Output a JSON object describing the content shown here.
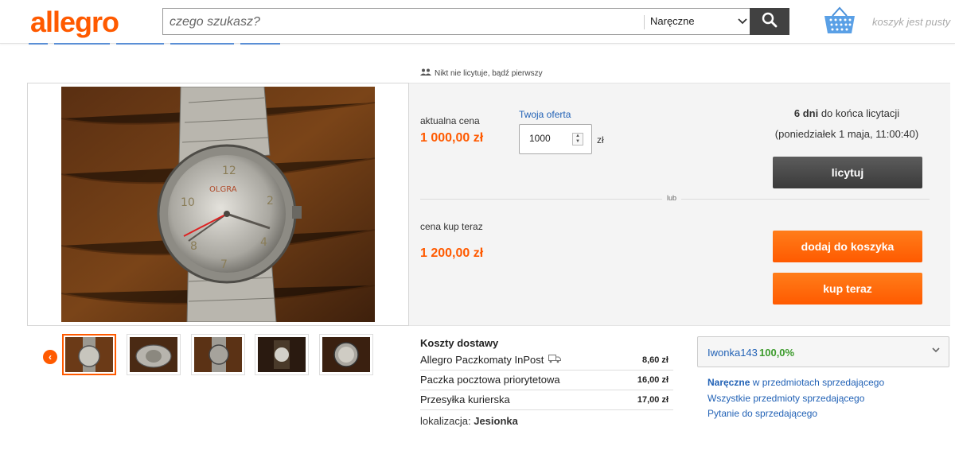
{
  "header": {
    "logo": "allegro",
    "search_placeholder": "czego szukasz?",
    "category": "Naręczne",
    "cart_text": "koszyk jest pusty"
  },
  "bid": {
    "note": "Nikt nie licytuje, bądź pierwszy",
    "current_price_label": "aktualna cena",
    "current_price": "1 000,00 zł",
    "offer_label": "Twoja oferta",
    "offer_value": "1000",
    "currency": "zł",
    "days_bold": "6 dni",
    "days_rest": " do końca licytacji",
    "end_date": "(poniedziałek 1 maja, 11:00:40)",
    "bid_button": "licytuj",
    "or_text": "lub",
    "buy_now_label": "cena kup teraz",
    "buy_now_price": "1 200,00 zł",
    "add_to_cart_button": "dodaj do koszyka",
    "buy_now_button": "kup teraz"
  },
  "delivery": {
    "title": "Koszty dostawy",
    "items": [
      {
        "name": "Allegro Paczkomaty InPost",
        "price": "8,60 zł"
      },
      {
        "name": "Paczka pocztowa priorytetowa",
        "price": "16,00 zł"
      },
      {
        "name": "Przesyłka kurierska",
        "price": "17,00 zł"
      }
    ],
    "location_label": "lokalizacja:",
    "location_value": "Jesionka"
  },
  "seller": {
    "name": "Iwonka143",
    "rating": "100,0%",
    "link1_bold": "Naręczne",
    "link1_rest": " w przedmiotach sprzedającego",
    "link2": "Wszystkie przedmioty sprzedającego",
    "link3": "Pytanie do sprzedającego"
  },
  "colors": {
    "brand": "#ff5a00",
    "link": "#2262b6",
    "rating": "#3c9b2c",
    "dark_button": "#414141"
  }
}
